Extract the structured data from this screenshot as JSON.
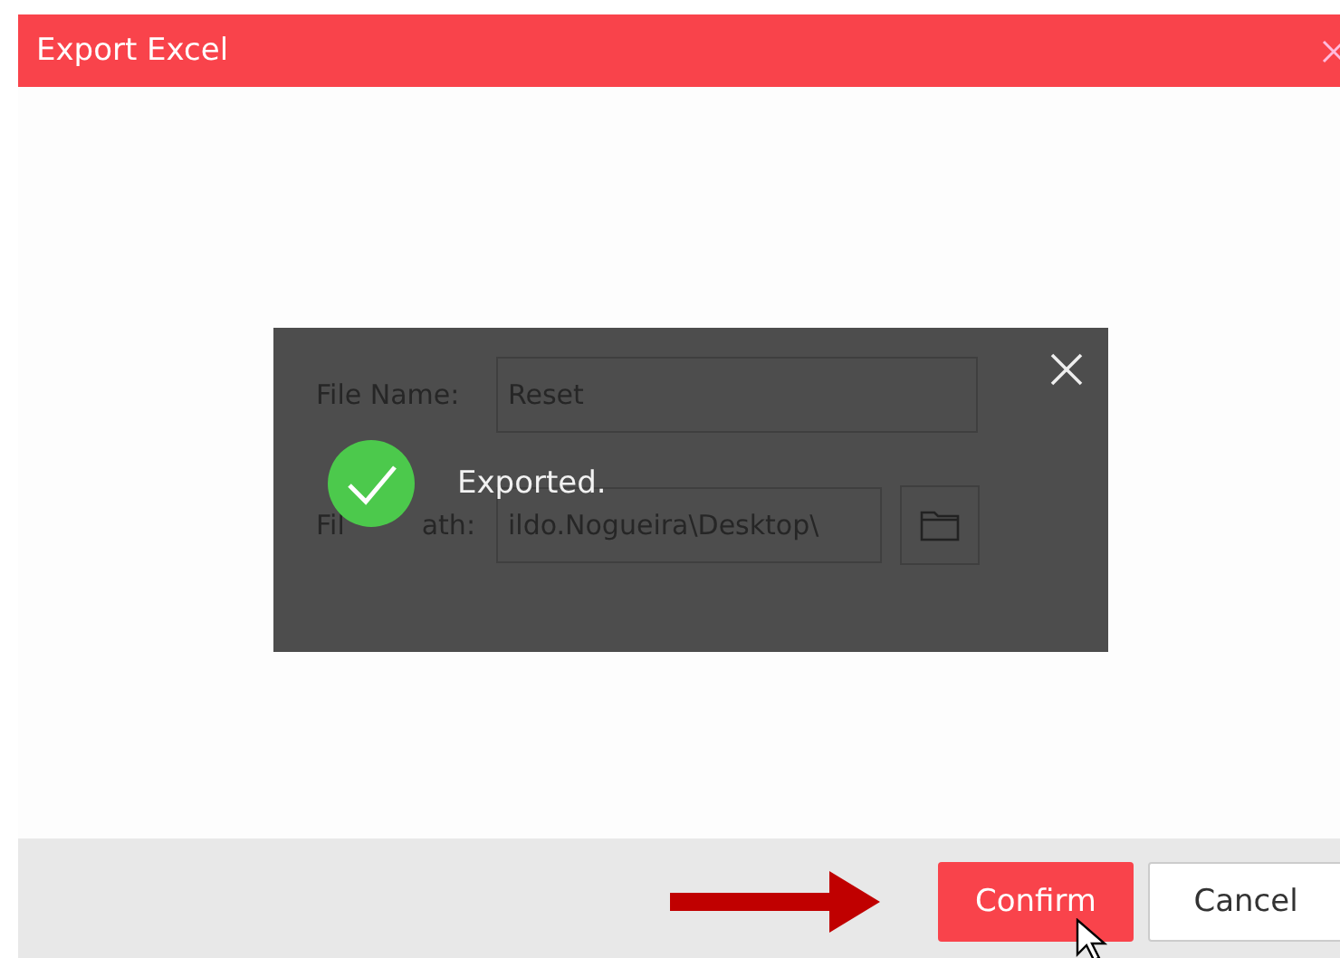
{
  "window": {
    "title": "Export Excel"
  },
  "form": {
    "fields": [
      {
        "label_parts": [
          "File Name:"
        ],
        "value": "Reset",
        "kind": "text"
      },
      {
        "label_parts": [
          "Fil",
          "ath:"
        ],
        "value": "ildo.Nogueira\\Desktop\\",
        "kind": "path"
      }
    ]
  },
  "toast": {
    "message": "Exported."
  },
  "buttons": [
    {
      "label": "Confirm",
      "kind": "primary"
    },
    {
      "label": "Cancel",
      "kind": "secondary"
    }
  ]
}
